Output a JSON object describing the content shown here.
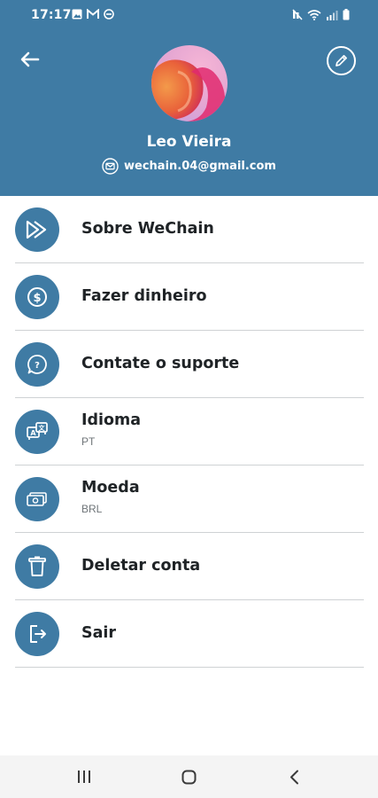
{
  "status_bar": {
    "time": "17:17",
    "left_icons": [
      "gallery-icon",
      "gmail-icon",
      "do-not-disturb-icon"
    ],
    "right_icons": [
      "mute-icon",
      "wifi-icon",
      "signal-icon",
      "battery-icon"
    ]
  },
  "header": {
    "background_color": "#3f7ba4",
    "back_icon": "arrow-left-icon",
    "edit_icon": "pencil-icon"
  },
  "profile": {
    "name": "Leo Vieira",
    "email": "wechain.04@gmail.com",
    "email_icon": "envelope-icon"
  },
  "menu": {
    "items": [
      {
        "label": "Sobre WeChain",
        "icon": "play-forward-icon"
      },
      {
        "label": "Fazer dinheiro",
        "icon": "dollar-coin-icon"
      },
      {
        "label": "Contate o suporte",
        "icon": "help-chat-icon"
      },
      {
        "label": "Idioma",
        "sublabel": "PT",
        "icon": "translate-icon"
      },
      {
        "label": "Moeda",
        "sublabel": "BRL",
        "icon": "banknote-icon"
      },
      {
        "label": "Deletar conta",
        "icon": "trash-icon"
      },
      {
        "label": "Sair",
        "icon": "logout-icon"
      }
    ]
  },
  "nav_bar": {
    "buttons": [
      "recent-apps-icon",
      "home-icon",
      "back-icon"
    ]
  }
}
